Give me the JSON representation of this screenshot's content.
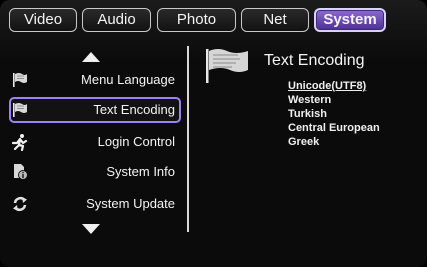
{
  "tabs": [
    {
      "label": "Video"
    },
    {
      "label": "Audio"
    },
    {
      "label": "Photo"
    },
    {
      "label": "Net"
    },
    {
      "label": "System"
    }
  ],
  "active_tab": "System",
  "menu": {
    "items": [
      {
        "label": "Menu Language",
        "icon": "flag-icon"
      },
      {
        "label": "Text Encoding",
        "icon": "flag-icon"
      },
      {
        "label": "Login Control",
        "icon": "runner-icon"
      },
      {
        "label": "System Info",
        "icon": "info-icon"
      },
      {
        "label": "System Update",
        "icon": "refresh-icon"
      }
    ],
    "selected": "Text Encoding"
  },
  "panel": {
    "title": "Text Encoding",
    "icon": "flag-icon",
    "options": [
      {
        "label": "Unicode(UTF8)"
      },
      {
        "label": "Western"
      },
      {
        "label": "Turkish"
      },
      {
        "label": "Central European"
      },
      {
        "label": "Greek"
      }
    ],
    "selected": "Unicode(UTF8)"
  },
  "colors": {
    "accent": "#6a46c2",
    "accent_border": "#9a85ee",
    "text": "#f4f4f4",
    "background": "#0b0b0b"
  }
}
